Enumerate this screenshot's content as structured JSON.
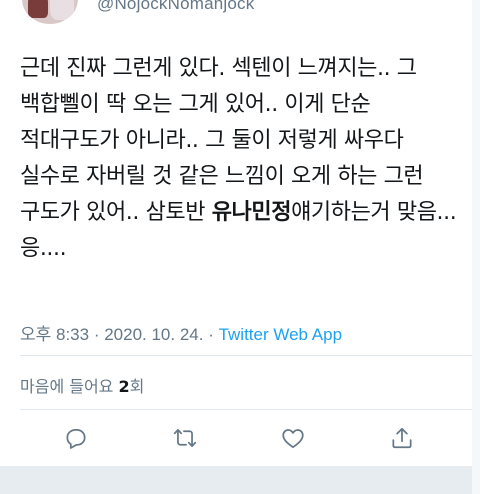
{
  "author": {
    "handle": "@NojockNomanjock"
  },
  "tweet": {
    "text_before": "근데 진짜 그런게 있다. 섹텐이 느껴지는.. 그 백합뻴이 딱 오는 그게 있어.. 이게 단순 적대구도가 아니라.. 그 둘이 저렇게 싸우다 실수로 자버릴 것 같은 느낌이 오게 하는 그런 구도가 있어.. 삼토반 ",
    "bold_name": "유나민정",
    "text_after": "얘기하는거 맞음... 응...."
  },
  "meta": {
    "time": "오후 8:33",
    "separator1": " · ",
    "date": "2020. 10. 24.",
    "separator2": " · ",
    "source": "Twitter Web App"
  },
  "likes": {
    "label": "마음에 들어요 ",
    "count": "2",
    "unit": "회"
  },
  "actions": [
    {
      "icon": "reply-icon"
    },
    {
      "icon": "retweet-icon"
    },
    {
      "icon": "like-icon"
    },
    {
      "icon": "share-icon"
    }
  ],
  "colors": {
    "text": "#14171a",
    "secondary": "#657786",
    "link": "#1da1f2",
    "divider": "#e1e8ed"
  }
}
